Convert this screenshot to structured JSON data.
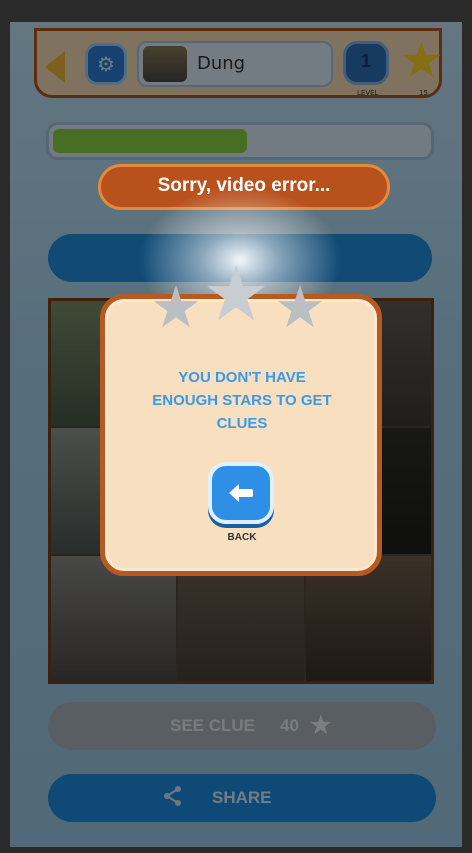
{
  "header": {
    "user_name": "Dung",
    "level": "1",
    "level_caption": "LEVEL",
    "stars_caption": "15"
  },
  "progress": {
    "fraction": 0.52
  },
  "toast": {
    "text": "Sorry, video error..."
  },
  "buttons": {
    "see_clue_label": "SEE CLUE",
    "see_clue_cost": "40",
    "share_label": "SHARE"
  },
  "modal": {
    "message": "YOU DON'T HAVE ENOUGH STARS TO GET CLUES",
    "back_label": "BACK",
    "stars_earned": 0,
    "stars_total": 3
  },
  "colors": {
    "accent_blue": "#1f8fe0",
    "frame_brown": "#b85a1f",
    "modal_bg": "#f7dfbf",
    "toast_bg": "#b8511c",
    "progress_green": "#8bd344"
  },
  "icons": [
    "back-arrow-icon",
    "gear-icon",
    "star-icon",
    "share-icon",
    "return-arrow-icon"
  ]
}
